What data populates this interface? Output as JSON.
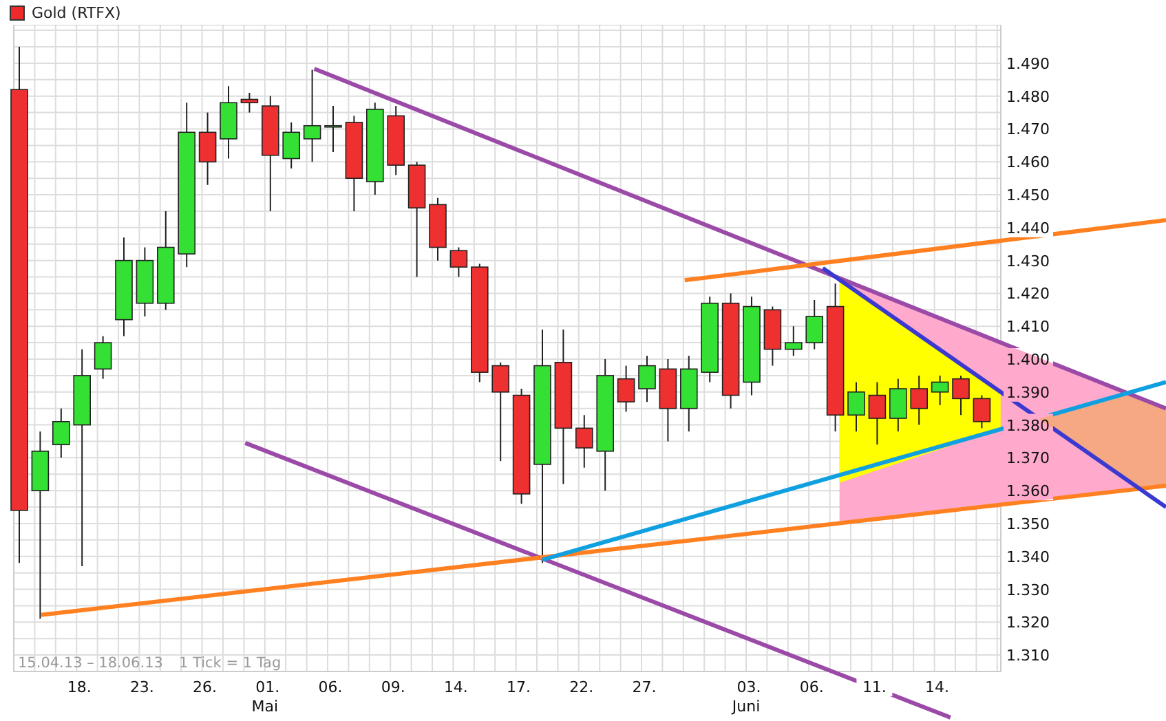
{
  "legend": {
    "label": "Gold (RTFX)"
  },
  "chart": {
    "range_label": "15.04.13 – 18.06.13",
    "tick_label": "1 Tick = 1 Tag",
    "month_labels": [
      "Mai",
      "Juni"
    ],
    "chart_data": {
      "type": "candlestick",
      "categories": [
        null,
        null,
        null,
        "18.",
        null,
        null,
        "23.",
        null,
        null,
        "26.",
        null,
        null,
        "01.",
        null,
        null,
        "06.",
        null,
        null,
        "09.",
        null,
        null,
        "14.",
        null,
        null,
        "17.",
        null,
        null,
        "22.",
        null,
        null,
        "27.",
        null,
        null,
        null,
        null,
        "03.",
        null,
        null,
        "06.",
        null,
        null,
        "11.",
        null,
        null,
        "14.",
        null,
        null
      ],
      "ohlc": [
        [
          1.482,
          1.495,
          1.338,
          1.354
        ],
        [
          1.36,
          1.378,
          1.321,
          1.372
        ],
        [
          1.374,
          1.385,
          1.37,
          1.381
        ],
        [
          1.38,
          1.403,
          1.337,
          1.395
        ],
        [
          1.397,
          1.407,
          1.394,
          1.405
        ],
        [
          1.412,
          1.437,
          1.407,
          1.43
        ],
        [
          1.417,
          1.434,
          1.413,
          1.43
        ],
        [
          1.417,
          1.445,
          1.415,
          1.434
        ],
        [
          1.432,
          1.478,
          1.428,
          1.469
        ],
        [
          1.469,
          1.475,
          1.453,
          1.46
        ],
        [
          1.467,
          1.483,
          1.461,
          1.478
        ],
        [
          1.479,
          1.481,
          1.475,
          1.478
        ],
        [
          1.477,
          1.48,
          1.445,
          1.462
        ],
        [
          1.461,
          1.472,
          1.458,
          1.469
        ],
        [
          1.467,
          1.488,
          1.46,
          1.471
        ],
        [
          1.471,
          1.477,
          1.463,
          1.471
        ],
        [
          1.472,
          1.474,
          1.445,
          1.455
        ],
        [
          1.454,
          1.478,
          1.45,
          1.476
        ],
        [
          1.474,
          1.477,
          1.456,
          1.459
        ],
        [
          1.459,
          1.46,
          1.425,
          1.446
        ],
        [
          1.447,
          1.449,
          1.43,
          1.434
        ],
        [
          1.433,
          1.434,
          1.425,
          1.428
        ],
        [
          1.428,
          1.429,
          1.393,
          1.396
        ],
        [
          1.398,
          1.399,
          1.369,
          1.39
        ],
        [
          1.389,
          1.391,
          1.356,
          1.359
        ],
        [
          1.368,
          1.409,
          1.338,
          1.398
        ],
        [
          1.399,
          1.409,
          1.362,
          1.379
        ],
        [
          1.379,
          1.383,
          1.367,
          1.373
        ],
        [
          1.372,
          1.4,
          1.36,
          1.395
        ],
        [
          1.394,
          1.398,
          1.384,
          1.387
        ],
        [
          1.391,
          1.401,
          1.387,
          1.398
        ],
        [
          1.397,
          1.4,
          1.375,
          1.385
        ],
        [
          1.385,
          1.401,
          1.378,
          1.397
        ],
        [
          1.396,
          1.419,
          1.393,
          1.417
        ],
        [
          1.417,
          1.42,
          1.385,
          1.389
        ],
        [
          1.393,
          1.419,
          1.389,
          1.416
        ],
        [
          1.415,
          1.416,
          1.398,
          1.403
        ],
        [
          1.403,
          1.41,
          1.401,
          1.405
        ],
        [
          1.405,
          1.418,
          1.403,
          1.413
        ],
        [
          1.416,
          1.423,
          1.378,
          1.383
        ],
        [
          1.383,
          1.393,
          1.378,
          1.39
        ],
        [
          1.389,
          1.393,
          1.374,
          1.382
        ],
        [
          1.382,
          1.394,
          1.378,
          1.391
        ],
        [
          1.391,
          1.395,
          1.38,
          1.385
        ],
        [
          1.39,
          1.395,
          1.386,
          1.393
        ],
        [
          1.394,
          1.395,
          1.383,
          1.388
        ],
        [
          1.388,
          1.389,
          1.379,
          1.381
        ]
      ],
      "ylim": [
        1.305,
        1.5017
      ],
      "grid": true,
      "yticks": [
        {
          "value": 1.31,
          "label": "1.310"
        },
        {
          "value": 1.32,
          "label": "1.320"
        },
        {
          "value": 1.33,
          "label": "1.330"
        },
        {
          "value": 1.34,
          "label": "1.340"
        },
        {
          "value": 1.35,
          "label": "1.350"
        },
        {
          "value": 1.36,
          "label": "1.360"
        },
        {
          "value": 1.37,
          "label": "1.370"
        },
        {
          "value": 1.38,
          "label": "1.380"
        },
        {
          "value": 1.39,
          "label": "1.390"
        },
        {
          "value": 1.4,
          "label": "1.400"
        },
        {
          "value": 1.41,
          "label": "1.410"
        },
        {
          "value": 1.42,
          "label": "1.420"
        },
        {
          "value": 1.43,
          "label": "1.430"
        },
        {
          "value": 1.44,
          "label": "1.440"
        },
        {
          "value": 1.45,
          "label": "1.450"
        },
        {
          "value": 1.46,
          "label": "1.460"
        },
        {
          "value": 1.47,
          "label": "1.470"
        },
        {
          "value": 1.48,
          "label": "1.480"
        },
        {
          "value": 1.49,
          "label": "1.490"
        }
      ]
    }
  }
}
